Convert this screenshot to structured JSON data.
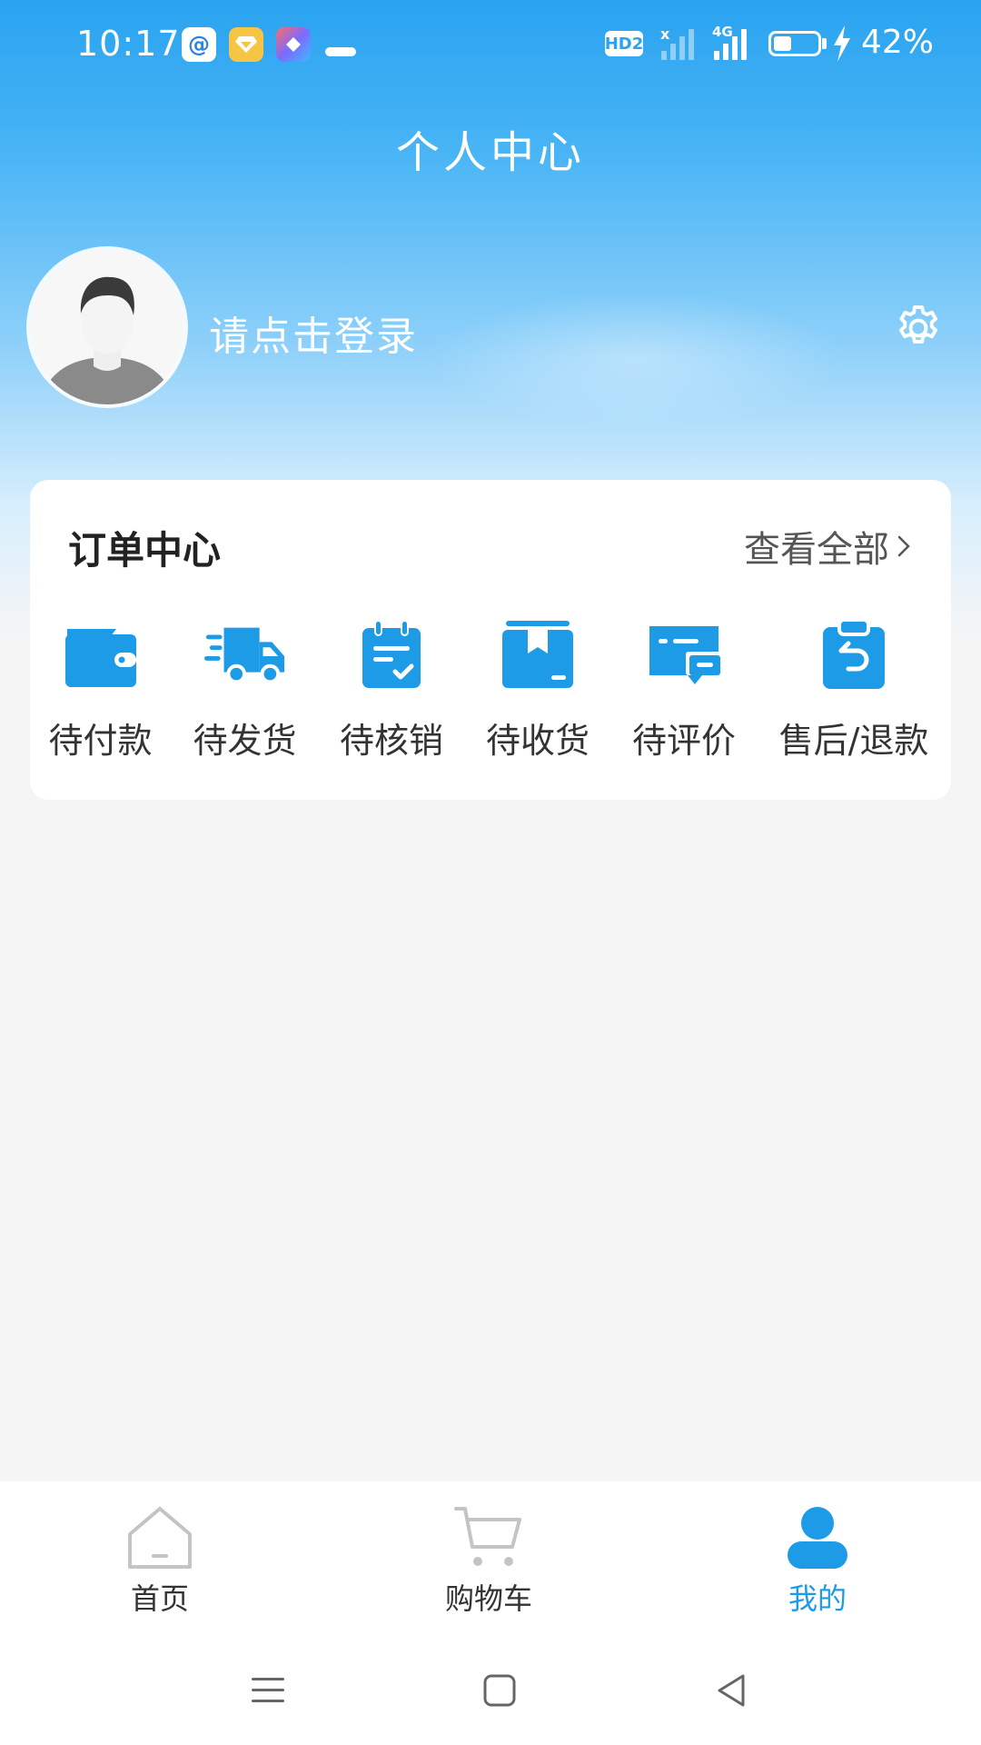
{
  "status_bar": {
    "time": "10:17",
    "hd_label": "HD2",
    "network_label": "4G",
    "no_signal_mark": "x",
    "battery_percent": "42%",
    "battery_level": 0.42,
    "apps": [
      "email-app-icon",
      "vip-diamond-app-icon",
      "gallery-app-icon",
      "cloud-app-icon"
    ]
  },
  "header": {
    "title": "个人中心"
  },
  "profile": {
    "login_prompt": "请点击登录",
    "settings_icon": "gear-icon"
  },
  "orders": {
    "title": "订单中心",
    "view_all": "查看全部",
    "items": [
      {
        "label": "待付款",
        "icon": "wallet-icon"
      },
      {
        "label": "待发货",
        "icon": "delivery-truck-icon"
      },
      {
        "label": "待核销",
        "icon": "calendar-check-icon"
      },
      {
        "label": "待收货",
        "icon": "package-box-icon"
      },
      {
        "label": "待评价",
        "icon": "comment-icon"
      },
      {
        "label": "售后/退款",
        "icon": "return-clipboard-icon"
      }
    ]
  },
  "tabbar": {
    "items": [
      {
        "label": "首页",
        "icon": "home-icon",
        "active": false
      },
      {
        "label": "购物车",
        "icon": "cart-icon",
        "active": false
      },
      {
        "label": "我的",
        "icon": "user-icon",
        "active": true
      }
    ]
  },
  "colors": {
    "primary": "#1e9be6",
    "header_top": "#2aa3f0",
    "background": "#f5f5f6",
    "icon_gray": "#c4c4c4"
  }
}
